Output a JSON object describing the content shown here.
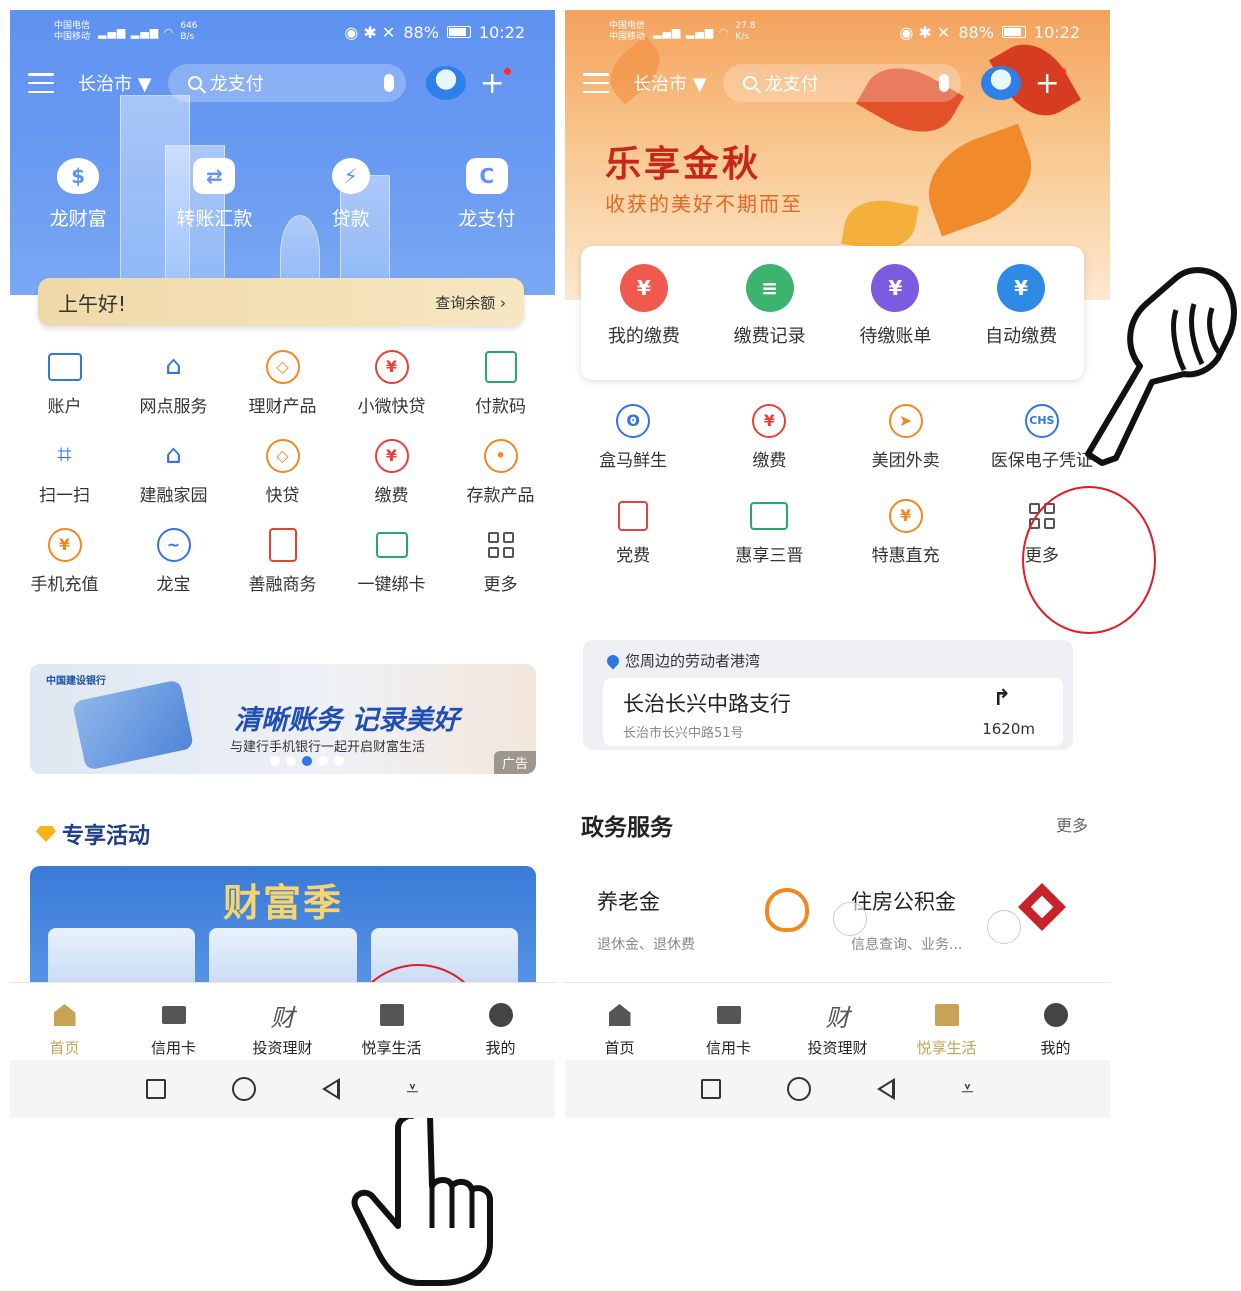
{
  "status": {
    "left_carrier": "中国电信 中国移动",
    "left_speed": "646 B/s",
    "right_carrier": "中国电信 中国移动",
    "right_speed": "27.8 K/s",
    "battery": "88%",
    "time": "10:22"
  },
  "header": {
    "city": "长治市 ▼",
    "search_placeholder": "龙支付"
  },
  "left_screen": {
    "quick_actions": [
      "龙财富",
      "转账汇款",
      "贷款",
      "龙支付"
    ],
    "greeting": "上午好!",
    "balance_link": "查询余额 ›",
    "services": [
      {
        "label": "账户",
        "icon": "wallet-icon"
      },
      {
        "label": "网点服务",
        "icon": "bank-icon"
      },
      {
        "label": "理财产品",
        "icon": "finance-icon"
      },
      {
        "label": "小微快贷",
        "icon": "moneybag-icon"
      },
      {
        "label": "付款码",
        "icon": "qrcode-icon"
      },
      {
        "label": "扫一扫",
        "icon": "scan-icon"
      },
      {
        "label": "建融家园",
        "icon": "house-icon"
      },
      {
        "label": "快贷",
        "icon": "loan-icon"
      },
      {
        "label": "缴费",
        "icon": "yen-icon"
      },
      {
        "label": "存款产品",
        "icon": "piggy-icon"
      },
      {
        "label": "手机充值",
        "icon": "topup-icon"
      },
      {
        "label": "龙宝",
        "icon": "longbao-icon"
      },
      {
        "label": "善融商务",
        "icon": "shop-icon"
      },
      {
        "label": "一键绑卡",
        "icon": "bindcard-icon"
      },
      {
        "label": "更多",
        "icon": "more-grid-icon"
      }
    ],
    "ad": {
      "bank": "中国建设银行",
      "headline": "清晰账务 记录美好",
      "subline": "与建行手机银行一起开启财富生活",
      "tag": "广告"
    },
    "exclusive_title": "专享活动",
    "promo_title": "财富季"
  },
  "right_screen": {
    "hero_title": "乐享金秋",
    "hero_subtitle": "收获的美好不期而至",
    "payments": [
      {
        "label": "我的缴费",
        "color": "#f05a4e"
      },
      {
        "label": "缴费记录",
        "color": "#3db46d"
      },
      {
        "label": "待缴账单",
        "color": "#7b5ce0"
      },
      {
        "label": "自动缴费",
        "color": "#2f8ae6"
      }
    ],
    "services": [
      {
        "label": "盒马鲜生",
        "icon": "hippo-icon"
      },
      {
        "label": "缴费",
        "icon": "yen-icon"
      },
      {
        "label": "美团外卖",
        "icon": "kangaroo-icon"
      },
      {
        "label": "医保电子凭证",
        "icon": "chs-icon"
      },
      {
        "label": "党费",
        "icon": "party-fee-icon"
      },
      {
        "label": "惠享三晋",
        "icon": "ticket-icon"
      },
      {
        "label": "特惠直充",
        "icon": "topup-icon"
      },
      {
        "label": "更多",
        "icon": "more-grid-icon"
      }
    ],
    "nearby": {
      "header": "您周边的劳动者港湾",
      "branch": "长治长兴中路支行",
      "address": "长治市长兴中路51号",
      "distance": "1620m"
    },
    "gov": {
      "title": "政务服务",
      "more": "更多",
      "items": [
        {
          "name": "养老金",
          "desc": "退休金、退休费"
        },
        {
          "name": "住房公积金",
          "desc": "信息查询、业务..."
        }
      ]
    }
  },
  "tabbar": [
    "首页",
    "信用卡",
    "投资理财",
    "悦享生活",
    "我的"
  ],
  "tab_glyph_invest": "财",
  "colors": {
    "left_header": "#5f92f1",
    "right_header": "#f4a15d",
    "active_tab": "#c8a255",
    "annotation": "#e41b23"
  }
}
